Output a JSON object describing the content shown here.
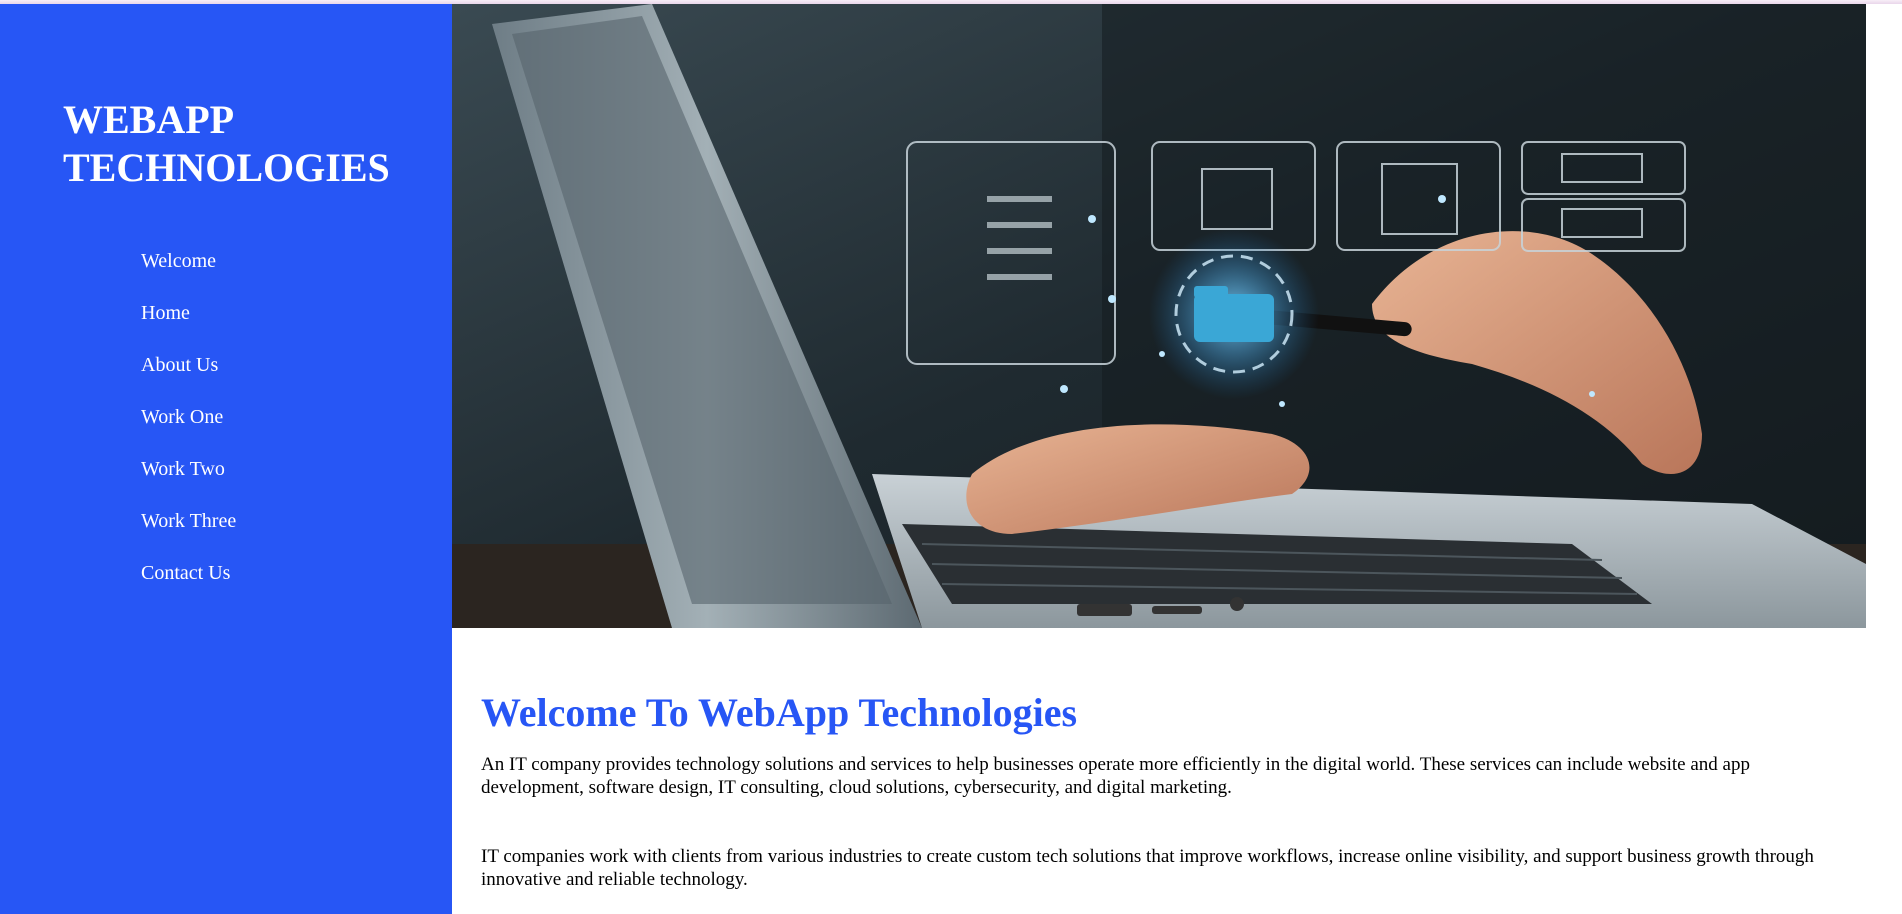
{
  "brand": {
    "name": "WEBAPP TECHNOLOGIES"
  },
  "nav": {
    "items": [
      {
        "label": "Welcome"
      },
      {
        "label": "Home"
      },
      {
        "label": "About Us"
      },
      {
        "label": "Work One"
      },
      {
        "label": "Work Two"
      },
      {
        "label": "Work Three"
      },
      {
        "label": "Contact Us"
      }
    ]
  },
  "hero": {
    "image": "laptop-hands-digital-document-icons"
  },
  "main": {
    "title": "Welcome To WebApp Technologies",
    "paragraphs": [
      "An IT company provides technology solutions and services to help businesses operate more efficiently in the digital world. These services can include website and app development, software design, IT consulting, cloud solutions, cybersecurity, and digital marketing.",
      "IT companies work with clients from various industries to create custom tech solutions that improve workflows, increase online visibility, and support business growth through innovative and reliable technology."
    ]
  },
  "colors": {
    "accent": "#2756f5",
    "sidebar_text": "#ffffff",
    "body_text": "#000000"
  }
}
